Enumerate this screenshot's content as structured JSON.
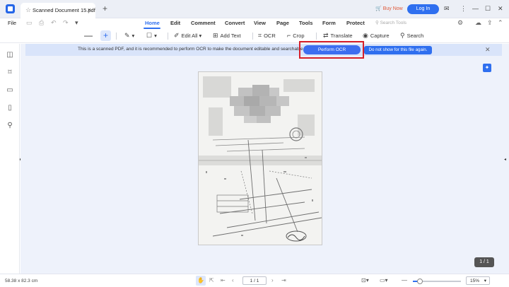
{
  "titlebar": {
    "tab_title": "Scanned Document 15.pdf",
    "buy_now": "Buy Now",
    "login": "Log In"
  },
  "menu": {
    "file": "File",
    "tabs": [
      {
        "label": "Home",
        "active": true
      },
      {
        "label": "Edit"
      },
      {
        "label": "Comment"
      },
      {
        "label": "Convert"
      },
      {
        "label": "View"
      },
      {
        "label": "Page"
      },
      {
        "label": "Tools"
      },
      {
        "label": "Form"
      },
      {
        "label": "Protect"
      }
    ],
    "search_tools": "Search Tools"
  },
  "toolbar": {
    "edit_all": "Edit All",
    "add_text": "Add Text",
    "ocr": "OCR",
    "crop": "Crop",
    "translate": "Translate",
    "capture": "Capture",
    "search": "Search"
  },
  "ocr_banner": {
    "message": "This is a scanned PDF, and it is recommended to perform OCR to make the document editable and searchable.",
    "perform_ocr": "Perform OCR",
    "dont_show": "Do not show for this file again."
  },
  "page_counter": "1 / 1",
  "status": {
    "dimensions": "58.38 x 82.3 cm",
    "page_input": "1 / 1",
    "zoom": "15%",
    "zoom_level": 0.15
  },
  "colors": {
    "accent": "#2f6fef",
    "highlight_frame": "#d6202a",
    "banner_bg": "#d9e4fa",
    "content_bg": "#eef2fb"
  }
}
